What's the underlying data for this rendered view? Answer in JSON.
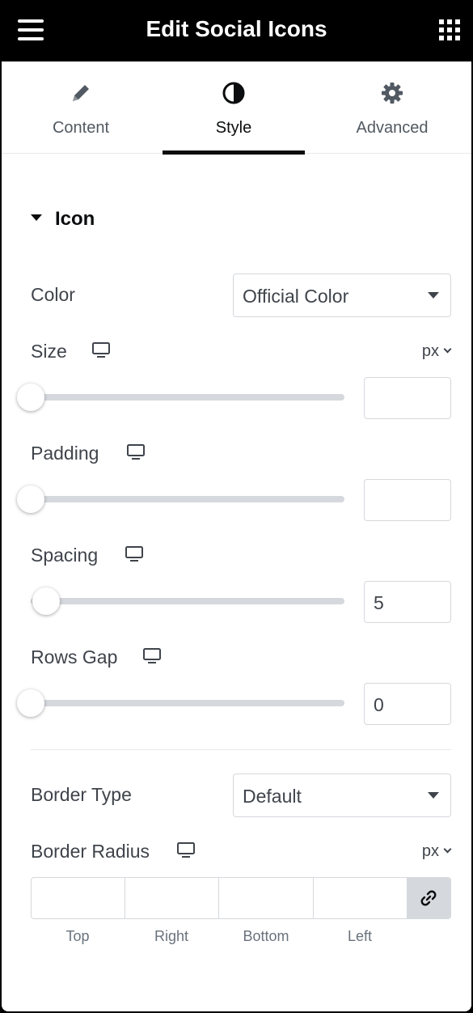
{
  "header": {
    "title": "Edit Social Icons"
  },
  "tabs": [
    {
      "label": "Content",
      "icon": "pencil-icon"
    },
    {
      "label": "Style",
      "icon": "contrast-icon"
    },
    {
      "label": "Advanced",
      "icon": "gear-icon"
    }
  ],
  "active_tab": "Style",
  "section": {
    "title": "Icon",
    "expanded": true
  },
  "controls": {
    "color": {
      "label": "Color",
      "value": "Official Color"
    },
    "size": {
      "label": "Size",
      "unit": "px",
      "value": "",
      "slider": 0
    },
    "padding": {
      "label": "Padding",
      "value": "",
      "slider": 0
    },
    "spacing": {
      "label": "Spacing",
      "value": "5",
      "slider": 0.05
    },
    "rows_gap": {
      "label": "Rows Gap",
      "value": "0",
      "slider": 0
    },
    "border_type": {
      "label": "Border Type",
      "value": "Default"
    },
    "border_radius": {
      "label": "Border Radius",
      "unit": "px",
      "sides": [
        "Top",
        "Right",
        "Bottom",
        "Left"
      ]
    }
  },
  "colors": {
    "header_bg": "#000000",
    "text": "#3f444b",
    "border": "#d5d8dc"
  }
}
